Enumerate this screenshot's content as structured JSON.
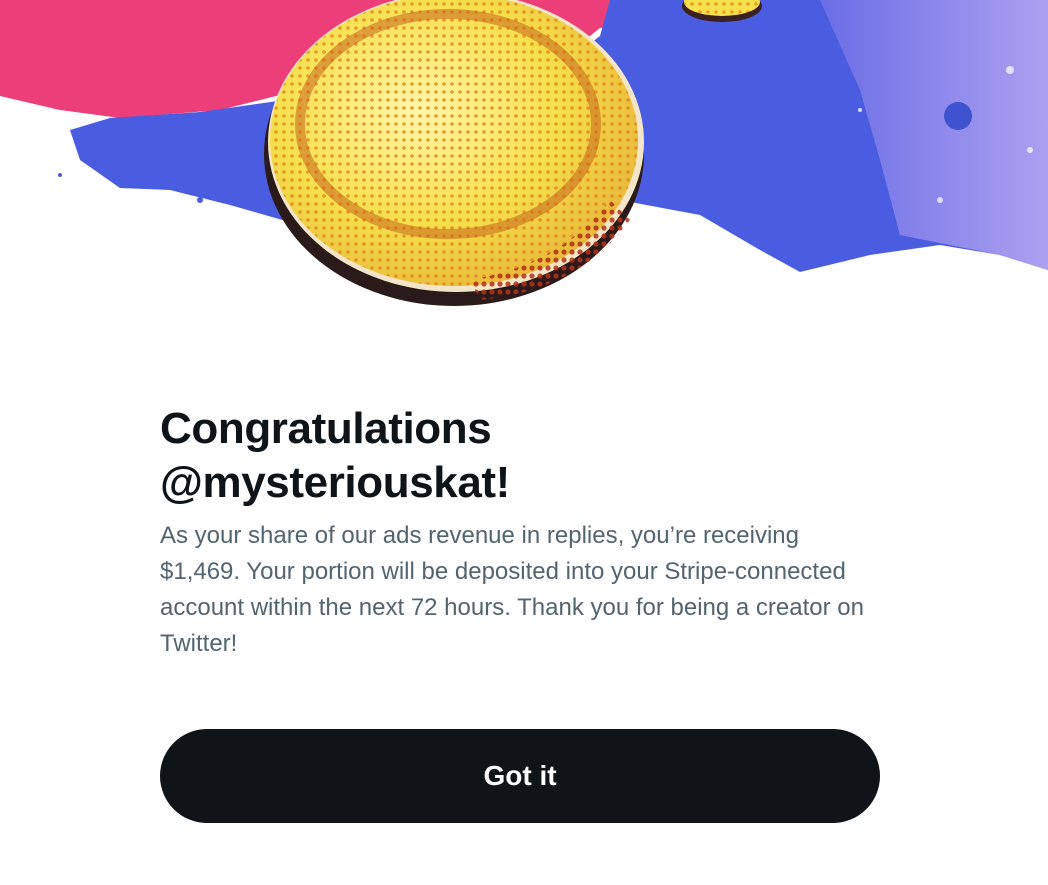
{
  "colors": {
    "background": "#ffffff",
    "headline": "#0f1419",
    "body_text": "#536471",
    "button_background": "#0f1419",
    "button_text": "#ffffff",
    "hero_pink": "#ec3f7a",
    "hero_blue": "#4a5de0",
    "hero_lavender": "#a598ee",
    "coin_yellow": "#f6df4a"
  },
  "hero": {
    "icon": "coin-illustration-icon"
  },
  "dialog": {
    "headline_line1": "Congratulations",
    "headline_line2": "@mysteriouskat!",
    "body": "As your share of our ads revenue in replies, you’re receiving $1,469. Your portion will be deposited into your Stripe-connected account within the next 72 hours. Thank you for being a creator on Twitter!",
    "button_label": "Got it"
  }
}
